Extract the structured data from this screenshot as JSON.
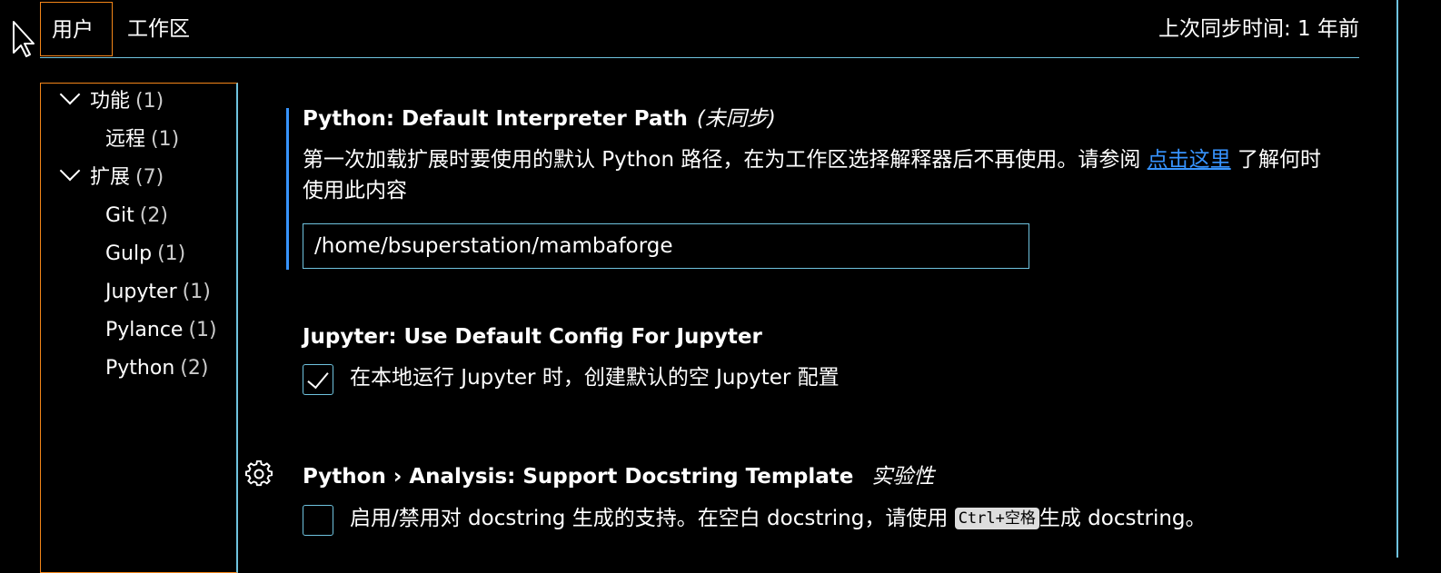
{
  "tabs": [
    {
      "label": "用户",
      "active": true
    },
    {
      "label": "工作区",
      "active": false
    }
  ],
  "sync_status": "上次同步时间: 1 年前",
  "toc": [
    {
      "label": "功能",
      "count": "(1)",
      "expanded": true
    },
    {
      "label": "远程",
      "count": "(1)"
    },
    {
      "label": "扩展",
      "count": "(7)",
      "expanded": true
    },
    {
      "label": "Git",
      "count": "(2)"
    },
    {
      "label": "Gulp",
      "count": "(1)"
    },
    {
      "label": "Jupyter",
      "count": "(1)"
    },
    {
      "label": "Pylance",
      "count": "(1)"
    },
    {
      "label": "Python",
      "count": "(2)"
    }
  ],
  "settings": {
    "interpreter": {
      "title": "Python: Default Interpreter Path",
      "tag": "(未同步)",
      "desc_before": "第一次加载扩展时要使用的默认 Python 路径，在为工作区选择解释器后不再使用。请参阅 ",
      "link": "点击这里",
      "desc_after": " 了解何时使用此内容",
      "value": "/home/bsuperstation/mambaforge"
    },
    "jupyter": {
      "title": "Jupyter: Use Default Config For Jupyter",
      "checked": true,
      "label": "在本地运行 Jupyter 时，创建默认的空 Jupyter 配置"
    },
    "docstring": {
      "title": "Python › Analysis: Support Docstring Template",
      "tag": "实验性",
      "checked": false,
      "label_before": "启用/禁用对 docstring 生成的支持。在空白 docstring，请使用 ",
      "kbd": "Ctrl+空格",
      "label_after": "生成 docstring。"
    }
  },
  "colors": {
    "background": "#000000",
    "focus_border": "#f38518",
    "contrast_border": "#6fc3df",
    "link": "#3794ff"
  },
  "icons": [
    "mouse-pointer-icon",
    "chevron-down-icon",
    "gear-icon",
    "check-icon"
  ]
}
